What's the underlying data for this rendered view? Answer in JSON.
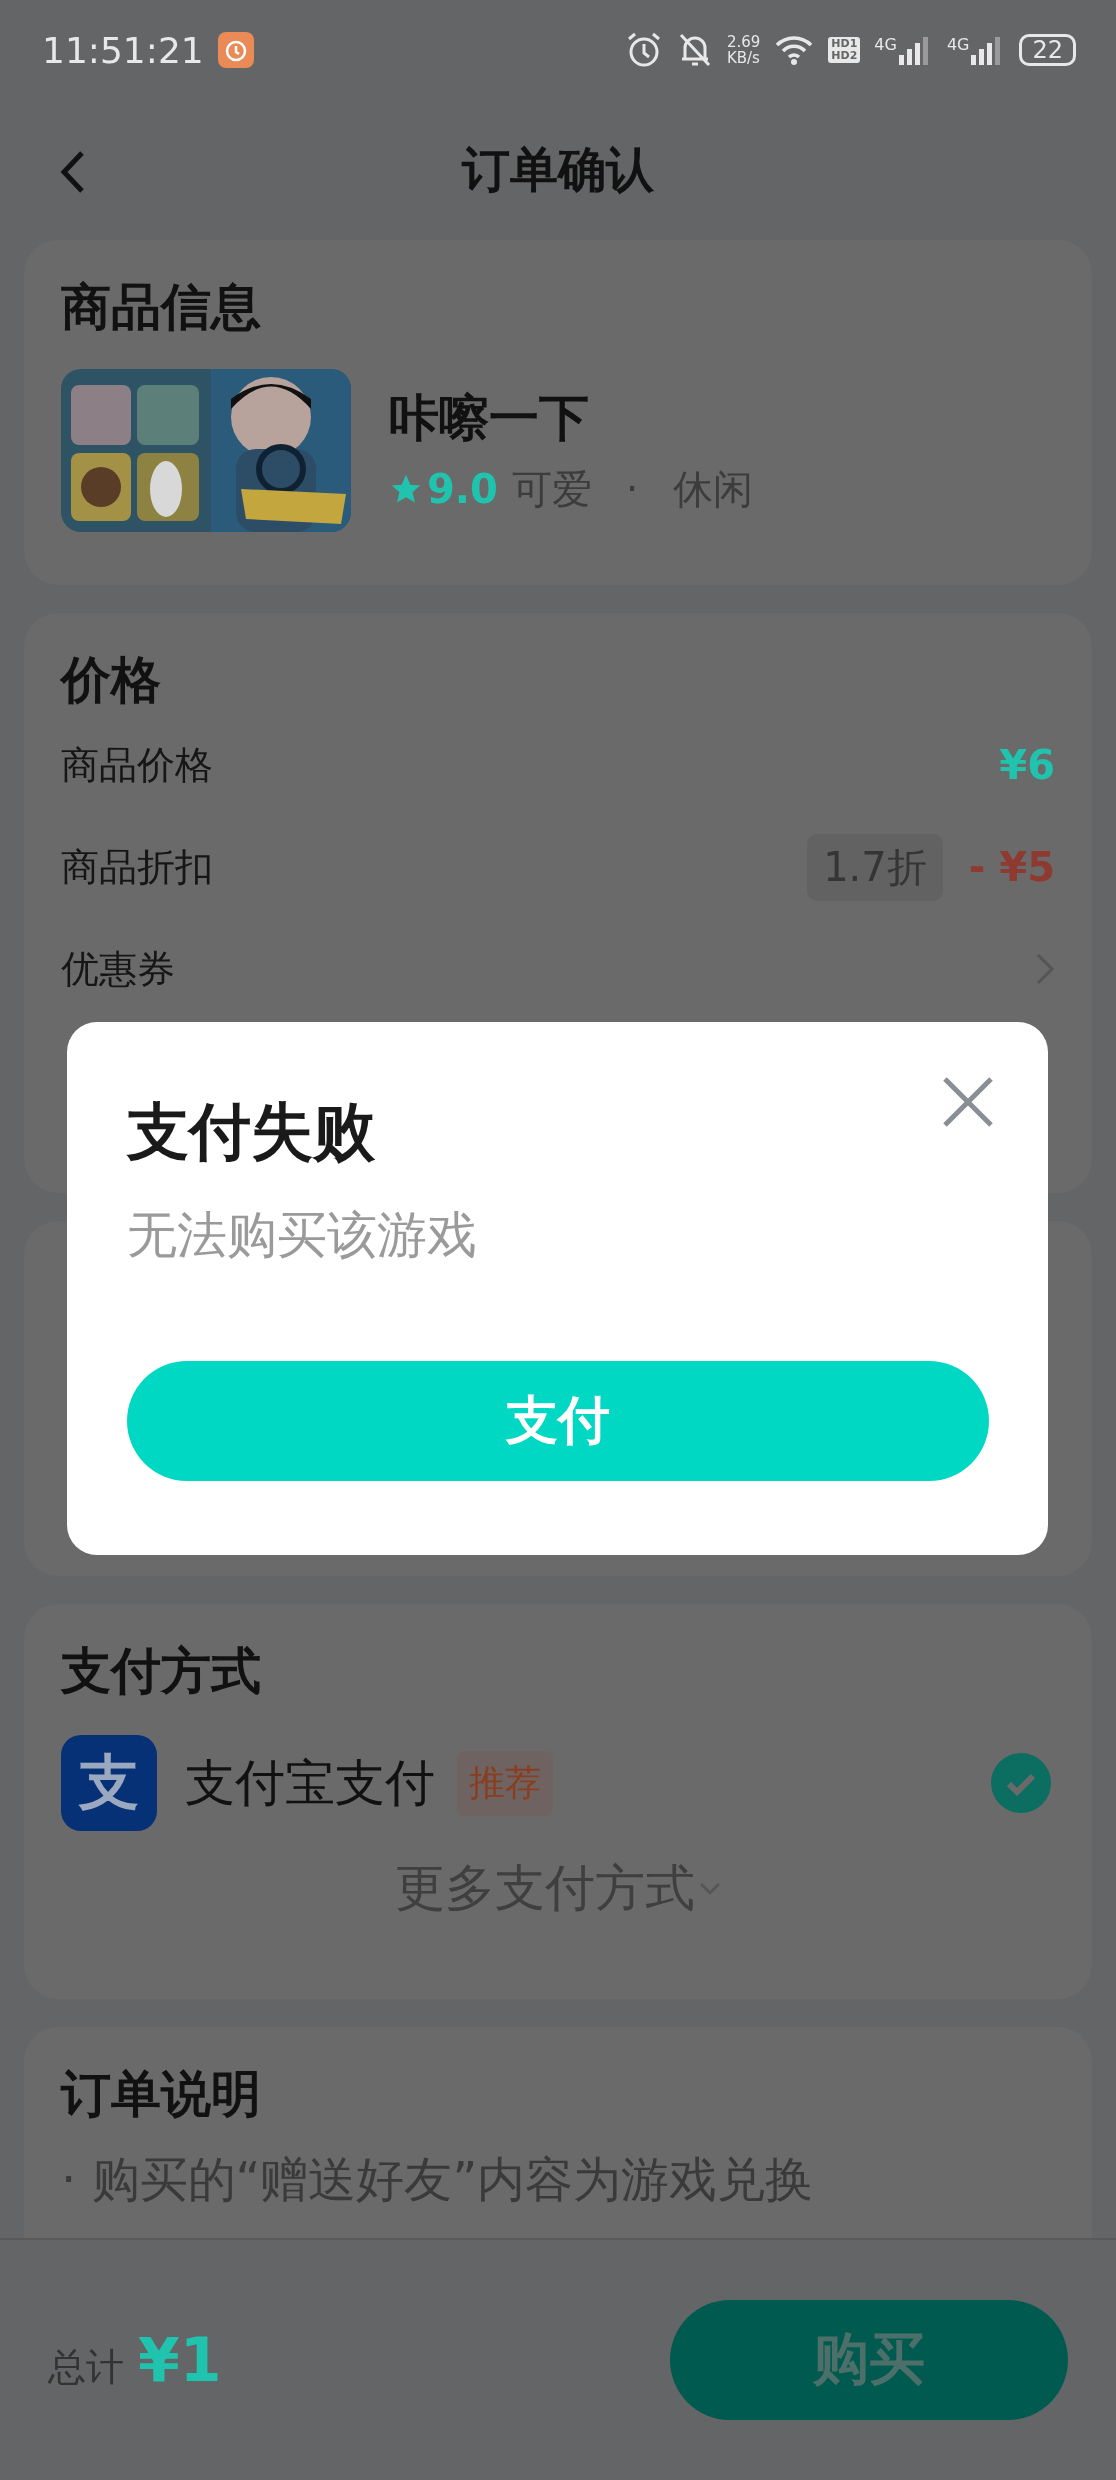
{
  "status_bar": {
    "time": "11:51:21",
    "speed_value": "2.69",
    "speed_unit": "KB/s",
    "hd_labels": [
      "HD1",
      "HD2"
    ],
    "networks": [
      "4G",
      "4G"
    ],
    "battery": "22"
  },
  "header": {
    "title": "订单确认"
  },
  "product": {
    "heading": "商品信息",
    "name": "咔嚓一下",
    "rating": "9.0",
    "tags": [
      "可爱",
      "休闲"
    ],
    "separator": "·"
  },
  "price": {
    "heading": "价格",
    "rows": [
      {
        "kind": "amount",
        "label": "商品价格",
        "value": "¥6"
      },
      {
        "kind": "discount",
        "label": "商品折扣",
        "badge": "1.7折",
        "value": "- ¥5"
      },
      {
        "kind": "link",
        "label": "优惠券"
      }
    ]
  },
  "payment": {
    "heading": "支付方式",
    "methods": [
      {
        "logo": "支",
        "name": "支付宝支付",
        "badge": "推荐",
        "selected": true
      }
    ],
    "more": "更多支付方式"
  },
  "notes": {
    "heading": "订单说明",
    "lines": [
      "· 购买的“赠送好友”内容为游戏兑换"
    ]
  },
  "footer": {
    "total_label": "总计",
    "total_value": "¥1",
    "buy": "购买"
  },
  "dialog": {
    "title": "支付失败",
    "message": "无法购买该游戏",
    "button": "支付"
  }
}
